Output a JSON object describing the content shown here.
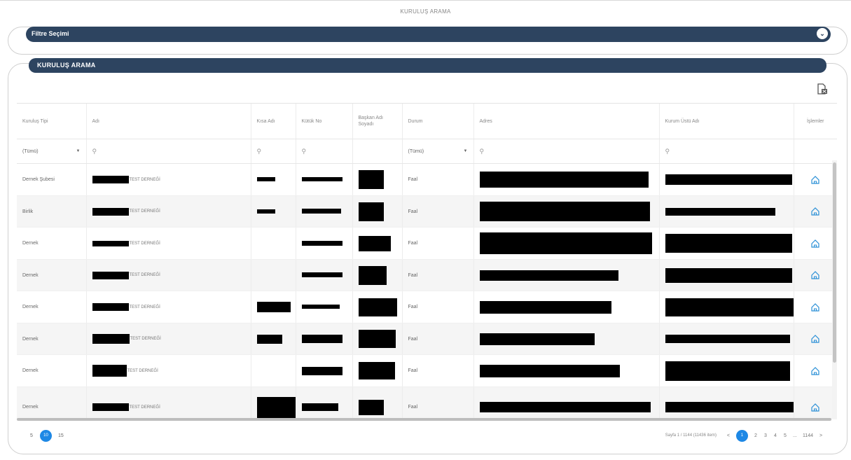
{
  "page": {
    "title": "KURULUŞ ARAMA"
  },
  "filter": {
    "label": "Filtre Seçimi"
  },
  "section": {
    "label": "KURULUŞ ARAMA"
  },
  "columns": [
    "Kuruluş Tipi",
    "Adı",
    "Kısa Adı",
    "Kütük No",
    "Başkan Adı Soyadı",
    "Durum",
    "Adres",
    "Kurum Üstü Adı",
    "İşlemler"
  ],
  "filters": {
    "type_value": "(Tümü)",
    "status_value": "(Tümü)",
    "search_icon": "search-icon",
    "dropdown_icon": "chevron-down-icon"
  },
  "rows": [
    {
      "type": "Dernek Şubesi",
      "name_suffix": "TEST DERNEĞİ",
      "status": "Faal"
    },
    {
      "type": "Birlik",
      "name_suffix": "TEST DERNEĞİ",
      "status": "Faal"
    },
    {
      "type": "Dernek",
      "name_suffix": "TEST DERNEĞİ",
      "status": "Faal"
    },
    {
      "type": "Dernek",
      "name_suffix": "TEST DERNEĞİ",
      "status": "Faal"
    },
    {
      "type": "Dernek",
      "name_suffix": "TEST DERNEĞİ",
      "status": "Faal"
    },
    {
      "type": "Dernek",
      "name_suffix": "TEST DERNEĞİ",
      "status": "Faal"
    },
    {
      "type": "Dernek",
      "name_suffix": "TEST DERNEĞİ",
      "status": "Faal"
    },
    {
      "type": "Dernek",
      "name_suffix": "TEST DERNEĞİ",
      "status": "Faal"
    }
  ],
  "pager": {
    "page_sizes": [
      "5",
      "10",
      "15"
    ],
    "active_page_size": "10",
    "info": "Sayfa 1 / 1144 (11436 item)",
    "prev_label": "<",
    "next_label": ">",
    "pages": [
      "1",
      "2",
      "3",
      "4",
      "5",
      "...",
      "1144"
    ],
    "active_page": "1"
  },
  "colors": {
    "bar": "#2d4460",
    "accent": "#1e88e5"
  }
}
